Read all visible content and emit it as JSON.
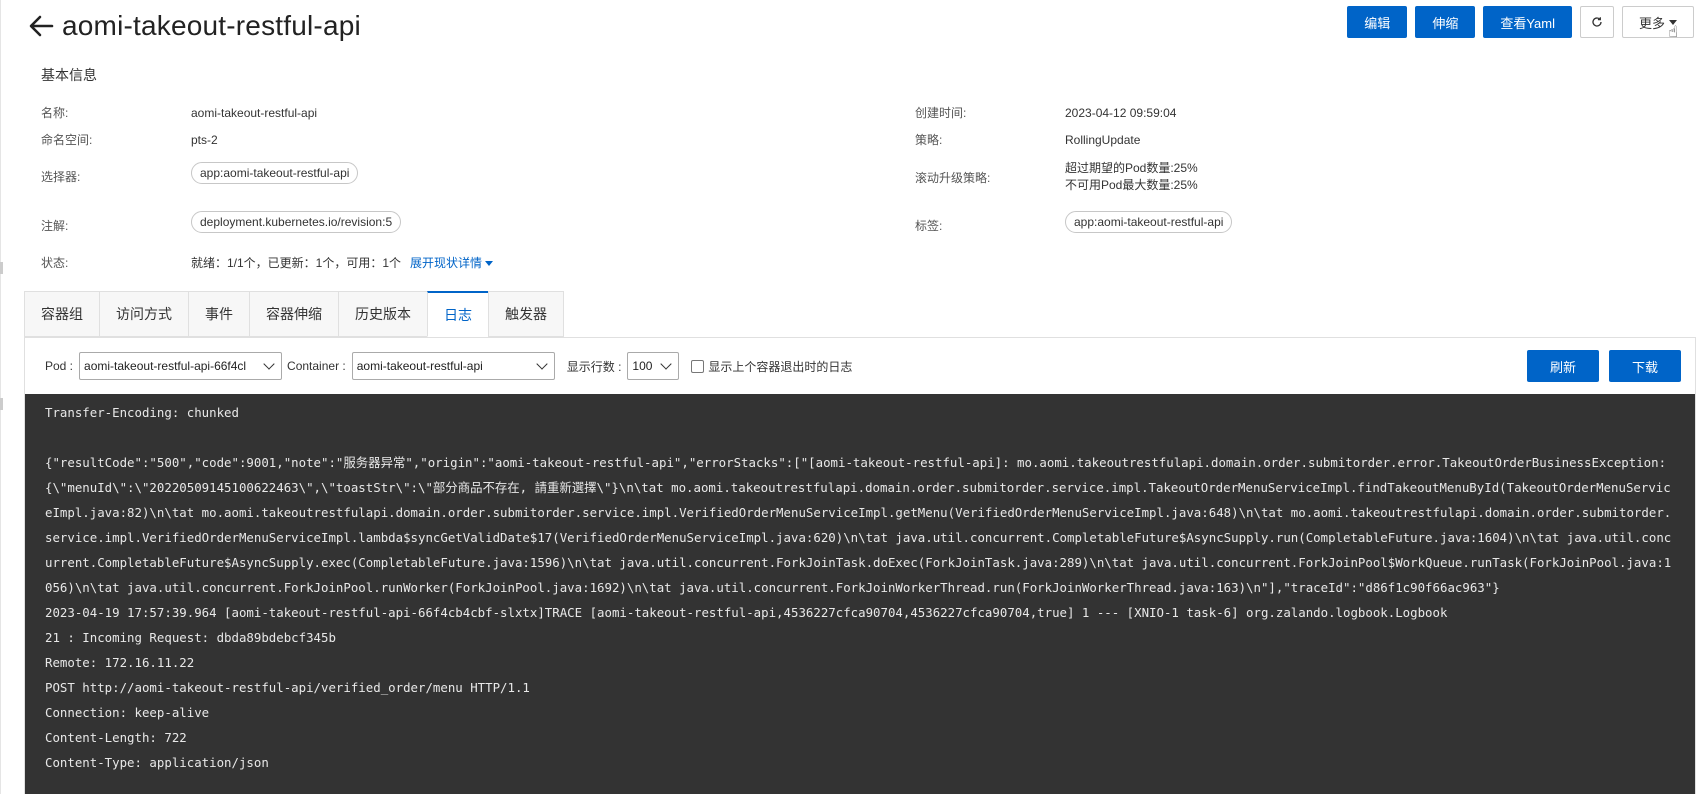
{
  "header": {
    "title": "aomi-takeout-restful-api",
    "buttons": {
      "edit": "编辑",
      "scale": "伸缩",
      "view_yaml": "查看Yaml",
      "more": "更多"
    }
  },
  "basic_info": {
    "section_title": "基本信息",
    "left": [
      {
        "label": "名称:",
        "value": "aomi-takeout-restful-api"
      },
      {
        "label": "命名空间:",
        "value": "pts-2"
      },
      {
        "label": "选择器:",
        "value": "app:aomi-takeout-restful-api"
      },
      {
        "label": "注解:",
        "value": "deployment.kubernetes.io/revision:5"
      },
      {
        "label": "状态:",
        "value": "就绪：1/1个，已更新：1个，可用：1个",
        "link": "展开现状详情"
      }
    ],
    "right": [
      {
        "label": "创建时间:",
        "value": "2023-04-12 09:59:04"
      },
      {
        "label": "策略:",
        "value": "RollingUpdate"
      },
      {
        "label": "滚动升级策略:",
        "value_line1": "超过期望的Pod数量:25%",
        "value_line2": "不可用Pod最大数量:25%"
      },
      {
        "label": "标签:",
        "value": "app:aomi-takeout-restful-api"
      }
    ]
  },
  "tabs": [
    {
      "label": "容器组",
      "active": false
    },
    {
      "label": "访问方式",
      "active": false
    },
    {
      "label": "事件",
      "active": false
    },
    {
      "label": "容器伸缩",
      "active": false
    },
    {
      "label": "历史版本",
      "active": false
    },
    {
      "label": "日志",
      "active": true
    },
    {
      "label": "触发器",
      "active": false
    }
  ],
  "log_toolbar": {
    "pod_label": "Pod :",
    "pod_value": "aomi-takeout-restful-api-66f4cl",
    "container_label": "Container :",
    "container_value": "aomi-takeout-restful-api",
    "lines_label": "显示行数 :",
    "lines_value": "100",
    "previous_checkbox_label": "显示上个容器退出时的日志",
    "refresh_label": "刷新",
    "download_label": "下载"
  },
  "log_lines": [
    "Transfer-Encoding: chunked",
    "",
    "{\"resultCode\":\"500\",\"code\":9001,\"note\":\"服务器异常\",\"origin\":\"aomi-takeout-restful-api\",\"errorStacks\":[\"[aomi-takeout-restful-api]: mo.aomi.takeoutrestfulapi.domain.order.submitorder.error.TakeoutOrderBusinessException: {\\\"menuId\\\":\\\"20220509145100622463\\\",\\\"toastStr\\\":\\\"部分商品不存在, 請重新選擇\\\"}\\n\\tat mo.aomi.takeoutrestfulapi.domain.order.submitorder.service.impl.TakeoutOrderMenuServiceImpl.findTakeoutMenuById(TakeoutOrderMenuServiceImpl.java:82)\\n\\tat mo.aomi.takeoutrestfulapi.domain.order.submitorder.service.impl.VerifiedOrderMenuServiceImpl.getMenu(VerifiedOrderMenuServiceImpl.java:648)\\n\\tat mo.aomi.takeoutrestfulapi.domain.order.submitorder.service.impl.VerifiedOrderMenuServiceImpl.lambda$syncGetValidDate$17(VerifiedOrderMenuServiceImpl.java:620)\\n\\tat java.util.concurrent.CompletableFuture$AsyncSupply.run(CompletableFuture.java:1604)\\n\\tat java.util.concurrent.CompletableFuture$AsyncSupply.exec(CompletableFuture.java:1596)\\n\\tat java.util.concurrent.ForkJoinTask.doExec(ForkJoinTask.java:289)\\n\\tat java.util.concurrent.ForkJoinPool$WorkQueue.runTask(ForkJoinPool.java:1056)\\n\\tat java.util.concurrent.ForkJoinPool.runWorker(ForkJoinPool.java:1692)\\n\\tat java.util.concurrent.ForkJoinWorkerThread.run(ForkJoinWorkerThread.java:163)\\n\"],\"traceId\":\"d86f1c90f66ac963\"}",
    "2023-04-19 17:57:39.964 [aomi-takeout-restful-api-66f4cb4cbf-slxtx]TRACE [aomi-takeout-restful-api,4536227cfca90704,4536227cfca90704,true] 1 --- [XNIO-1 task-6] org.zalando.logbook.Logbook",
    "21 : Incoming Request: dbda89bdebcf345b",
    "Remote: 172.16.11.22",
    "POST http://aomi-takeout-restful-api/verified_order/menu HTTP/1.1",
    "Connection: keep-alive",
    "Content-Length: 722",
    "Content-Type: application/json"
  ]
}
